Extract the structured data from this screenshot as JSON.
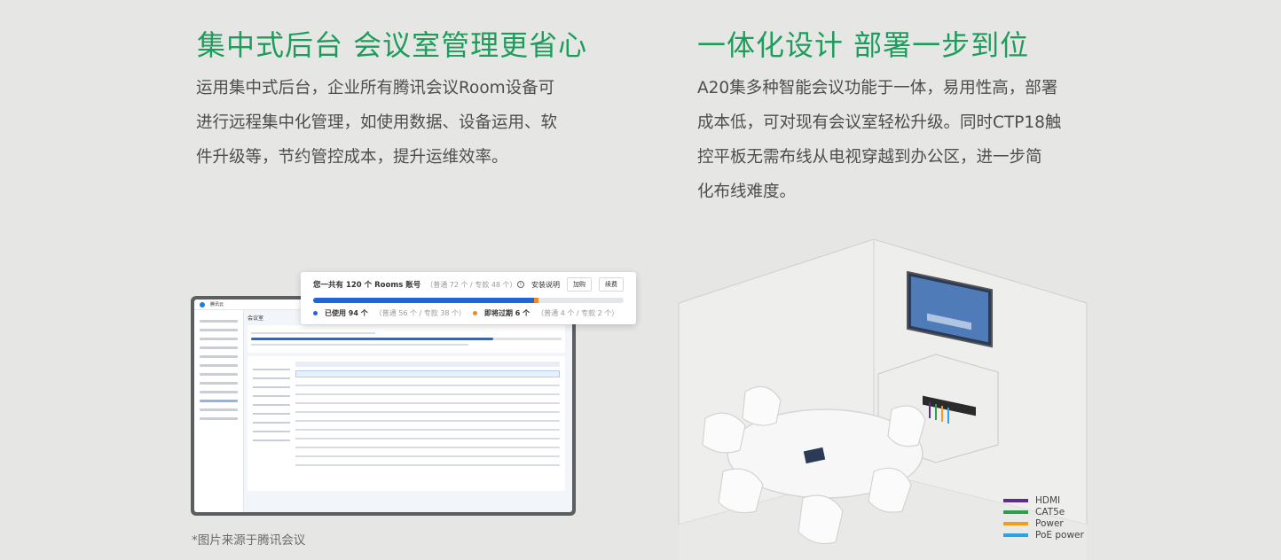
{
  "left": {
    "title": "集中式后台 会议室管理更省心",
    "lines": [
      "运用集中式后台，企业所有腾讯会议Room设备可",
      "进行远程集中化管理，如使用数据、设备运用、软",
      "件升级等，节约管控成本，提升运维效率。"
    ]
  },
  "right": {
    "title": "一体化设计 部署一步到位",
    "lines": [
      "A20集多种智能会议功能于一体，易用性高，部署",
      "成本低，可对现有会议室轻松升级。同时CTP18触",
      "控平板无需布线从电视穿越到办公区，进一步简",
      "化布线难度。"
    ]
  },
  "popup": {
    "total": "您一共有 120 个 Rooms 账号",
    "total_sub": "（普通 72 个 / 专款 48 个）",
    "install_label": "安装说明",
    "buy_label": "加购",
    "renew_label": "续费",
    "used": "已使用 94 个",
    "used_sub": "（普通 56 个 / 专款 38 个）",
    "expiring": "即将过期 6 个",
    "expiring_sub": "（普通 4 个 / 专款 2 个）",
    "used_fraction": 0.71,
    "expiring_fraction": 0.015
  },
  "laptop": {
    "app_name": "腾讯云",
    "page_title": "会议室"
  },
  "caption": "*图片来源于腾讯会议",
  "legend": [
    {
      "label": "HDMI",
      "color": "#5b2d8c"
    },
    {
      "label": "CAT5e",
      "color": "#2e9e4a"
    },
    {
      "label": "Power",
      "color": "#f39c1a"
    },
    {
      "label": "PoE power",
      "color": "#2aa3e6"
    }
  ],
  "colors": {
    "accent": "#1e9c5c",
    "bar_used": "#1f67d8",
    "bar_expiring": "#f08a1e"
  }
}
